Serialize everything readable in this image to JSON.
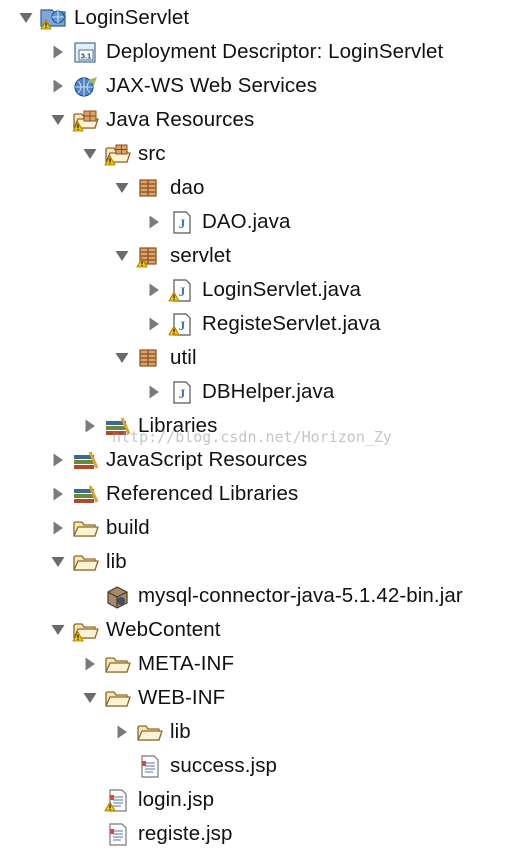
{
  "tree": [
    {
      "label": "LoginServlet",
      "depth": 0,
      "expanded": true,
      "icon": "web-project-warning-icon",
      "name": "project-loginservlet"
    },
    {
      "label": "Deployment Descriptor: LoginServlet",
      "depth": 1,
      "expanded": false,
      "icon": "deployment-descriptor-icon",
      "name": "node-deployment-descriptor"
    },
    {
      "label": "JAX-WS Web Services",
      "depth": 1,
      "expanded": false,
      "icon": "web-services-icon",
      "name": "node-jaxws-web-services"
    },
    {
      "label": "Java Resources",
      "depth": 1,
      "expanded": true,
      "icon": "java-resources-warning-icon",
      "name": "node-java-resources"
    },
    {
      "label": "src",
      "depth": 2,
      "expanded": true,
      "icon": "source-folder-warning-icon",
      "name": "node-src"
    },
    {
      "label": "dao",
      "depth": 3,
      "expanded": true,
      "icon": "package-icon",
      "name": "node-package-dao"
    },
    {
      "label": "DAO.java",
      "depth": 4,
      "expanded": false,
      "icon": "java-file-icon",
      "name": "node-dao-java"
    },
    {
      "label": "servlet",
      "depth": 3,
      "expanded": true,
      "icon": "package-warning-icon",
      "name": "node-package-servlet"
    },
    {
      "label": "LoginServlet.java",
      "depth": 4,
      "expanded": false,
      "icon": "java-file-warning-icon",
      "name": "node-loginservlet-java"
    },
    {
      "label": "RegisteServlet.java",
      "depth": 4,
      "expanded": false,
      "icon": "java-file-warning-icon",
      "name": "node-registeservlet-java"
    },
    {
      "label": "util",
      "depth": 3,
      "expanded": true,
      "icon": "package-icon",
      "name": "node-package-util"
    },
    {
      "label": "DBHelper.java",
      "depth": 4,
      "expanded": false,
      "icon": "java-file-icon",
      "name": "node-dbhelper-java"
    },
    {
      "label": "Libraries",
      "depth": 2,
      "expanded": false,
      "icon": "libraries-icon",
      "name": "node-libraries"
    },
    {
      "label": "JavaScript Resources",
      "depth": 1,
      "expanded": false,
      "icon": "libraries-icon",
      "name": "node-javascript-resources"
    },
    {
      "label": "Referenced Libraries",
      "depth": 1,
      "expanded": false,
      "icon": "libraries-icon",
      "name": "node-referenced-libraries"
    },
    {
      "label": "build",
      "depth": 1,
      "expanded": false,
      "icon": "folder-icon",
      "name": "node-build"
    },
    {
      "label": "lib",
      "depth": 1,
      "expanded": true,
      "icon": "folder-icon",
      "name": "node-lib"
    },
    {
      "label": "mysql-connector-java-5.1.42-bin.jar",
      "depth": 2,
      "leaf": true,
      "icon": "jar-file-icon",
      "name": "node-mysql-connector-jar"
    },
    {
      "label": "WebContent",
      "depth": 1,
      "expanded": true,
      "icon": "folder-warning-icon",
      "name": "node-webcontent"
    },
    {
      "label": "META-INF",
      "depth": 2,
      "expanded": false,
      "icon": "folder-icon",
      "name": "node-meta-inf"
    },
    {
      "label": "WEB-INF",
      "depth": 2,
      "expanded": true,
      "icon": "folder-icon",
      "name": "node-web-inf"
    },
    {
      "label": "lib",
      "depth": 3,
      "expanded": false,
      "icon": "folder-icon",
      "name": "node-web-inf-lib"
    },
    {
      "label": "success.jsp",
      "depth": 3,
      "leaf": true,
      "icon": "jsp-file-icon",
      "name": "node-success-jsp"
    },
    {
      "label": "login.jsp",
      "depth": 2,
      "leaf": true,
      "icon": "jsp-file-warning-icon",
      "name": "node-login-jsp"
    },
    {
      "label": "registe.jsp",
      "depth": 2,
      "leaf": true,
      "icon": "jsp-file-icon",
      "name": "node-registe-jsp"
    }
  ],
  "watermark": "http://blog.csdn.net/Horizon_Zy"
}
